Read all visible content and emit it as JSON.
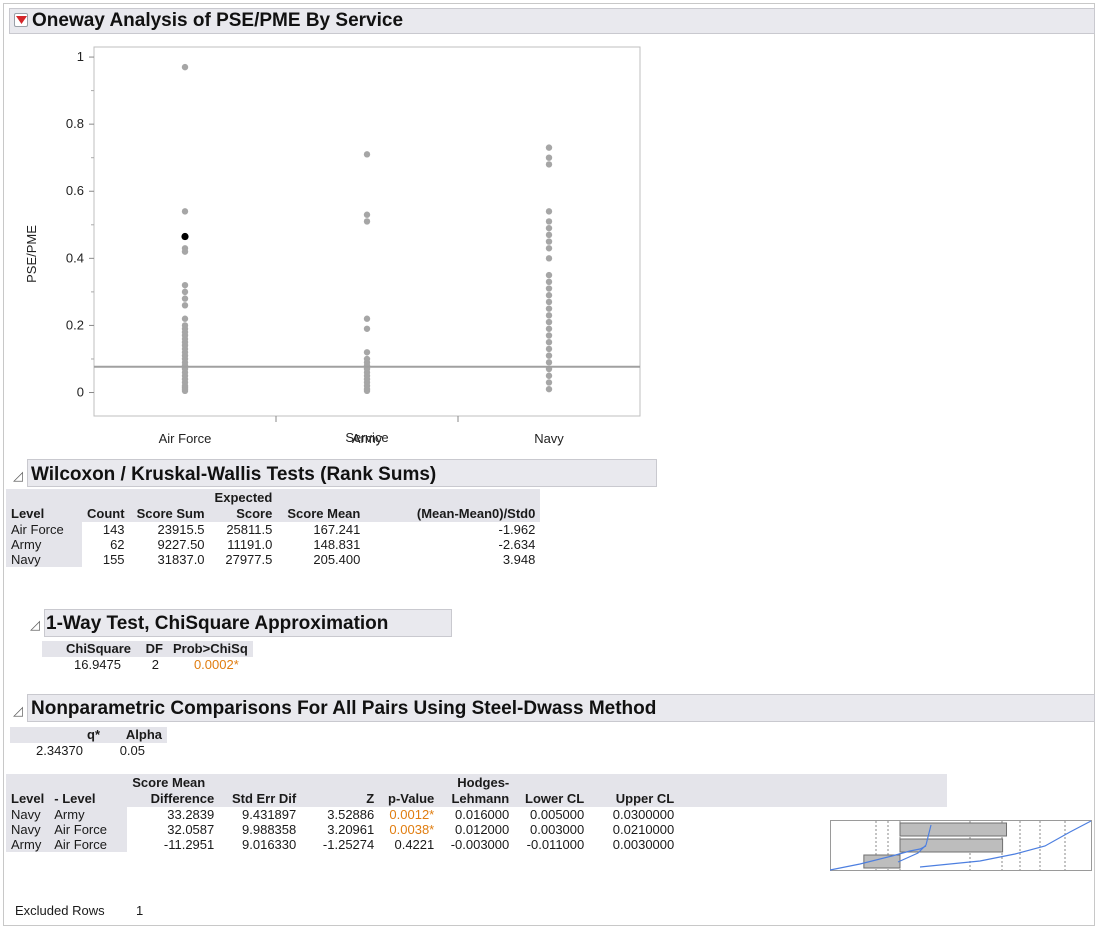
{
  "report": {
    "title": "Oneway Analysis of PSE/PME By Service"
  },
  "chart_data": {
    "type": "scatter",
    "xlabel": "Service",
    "ylabel": "PSE/PME",
    "categories": [
      "Air Force",
      "Army",
      "Navy"
    ],
    "ylim": [
      -0.07,
      1.03
    ],
    "yticks": [
      "0",
      "0.2",
      "0.4",
      "0.6",
      "0.8",
      "1"
    ],
    "reference_line_y": 0.077,
    "grid": false,
    "series": [
      {
        "category": "Air Force",
        "values": [
          0.97,
          0.54,
          0.465,
          0.43,
          0.42,
          0.32,
          0.3,
          0.28,
          0.26,
          0.22,
          0.2,
          0.19,
          0.18,
          0.17,
          0.16,
          0.15,
          0.14,
          0.13,
          0.12,
          0.11,
          0.1,
          0.09,
          0.08,
          0.07,
          0.06,
          0.05,
          0.04,
          0.03,
          0.02,
          0.015,
          0.01,
          0.005
        ],
        "highlighted": [
          0.465
        ]
      },
      {
        "category": "Army",
        "values": [
          0.71,
          0.53,
          0.51,
          0.22,
          0.19,
          0.12,
          0.1,
          0.09,
          0.08,
          0.07,
          0.06,
          0.05,
          0.04,
          0.03,
          0.02,
          0.01,
          0.005
        ],
        "highlighted": []
      },
      {
        "category": "Navy",
        "values": [
          0.73,
          0.7,
          0.68,
          0.54,
          0.51,
          0.49,
          0.47,
          0.45,
          0.43,
          0.4,
          0.35,
          0.33,
          0.31,
          0.29,
          0.27,
          0.25,
          0.23,
          0.21,
          0.19,
          0.17,
          0.15,
          0.13,
          0.11,
          0.09,
          0.07,
          0.05,
          0.03,
          0.01
        ],
        "highlighted": []
      }
    ]
  },
  "wilcoxon": {
    "title": "Wilcoxon / Kruskal-Wallis Tests (Rank Sums)",
    "headers": {
      "level": "Level",
      "count": "Count",
      "score_sum": "Score Sum",
      "expected_1": "Expected",
      "expected_2": "Score",
      "score_mean": "Score Mean",
      "mean_std": "(Mean-Mean0)/Std0"
    },
    "rows": [
      {
        "level": "Air Force",
        "count": "143",
        "score_sum": "23915.5",
        "expected": "25811.5",
        "score_mean": "167.241",
        "mean_std": "-1.962"
      },
      {
        "level": "Army",
        "count": "62",
        "score_sum": "9227.50",
        "expected": "11191.0",
        "score_mean": "148.831",
        "mean_std": "-2.634"
      },
      {
        "level": "Navy",
        "count": "155",
        "score_sum": "31837.0",
        "expected": "27977.5",
        "score_mean": "205.400",
        "mean_std": "3.948"
      }
    ]
  },
  "chisq": {
    "title": "1-Way Test, ChiSquare Approximation",
    "headers": {
      "chisq": "ChiSquare",
      "df": "DF",
      "prob": "Prob>ChiSq"
    },
    "values": {
      "chisq": "16.9475",
      "df": "2",
      "prob": "0.0002*"
    }
  },
  "steel_dwass": {
    "title": "Nonparametric Comparisons For All Pairs Using Steel-Dwass  Method",
    "q_header": "q*",
    "alpha_header": "Alpha",
    "q_value": "2.34370",
    "alpha_value": "0.05",
    "headers": {
      "level": "Level",
      "minus_level": "- Level",
      "score_mean_diff_1": "Score Mean",
      "score_mean_diff_2": "Difference",
      "std_err": "Std Err Dif",
      "z": "Z",
      "p_value": "p-Value",
      "hodges_1": "Hodges-",
      "hodges_2": "Lehmann",
      "lower": "Lower CL",
      "upper": "Upper CL"
    },
    "rows": [
      {
        "level": "Navy",
        "minus_level": "Army",
        "diff": "33.2839",
        "std_err": "9.431897",
        "z": "3.52886",
        "p": "0.0012*",
        "p_sig": true,
        "hl": "0.016000",
        "lower": "0.005000",
        "upper": "0.0300000",
        "diff_value": 33.2839
      },
      {
        "level": "Navy",
        "minus_level": "Air Force",
        "diff": "32.0587",
        "std_err": "9.988358",
        "z": "3.20961",
        "p": "0.0038*",
        "p_sig": true,
        "hl": "0.012000",
        "lower": "0.003000",
        "upper": "0.0210000",
        "diff_value": 32.0587
      },
      {
        "level": "Army",
        "minus_level": "Air Force",
        "diff": "-11.2951",
        "std_err": "9.016330",
        "z": "-1.25274",
        "p": "0.4221",
        "p_sig": false,
        "hl": "-0.003000",
        "lower": "-0.011000",
        "upper": "0.0030000",
        "diff_value": -11.2951
      }
    ]
  },
  "excluded": {
    "label": "Excluded Rows",
    "value": "1"
  },
  "colors": {
    "point": "#a6a6a6",
    "highlight_point": "#000000",
    "ref_line": "#a0a0a0",
    "bar": "#bdbdbd",
    "curve": "#4d7fe0",
    "significant": "#e07d10"
  }
}
